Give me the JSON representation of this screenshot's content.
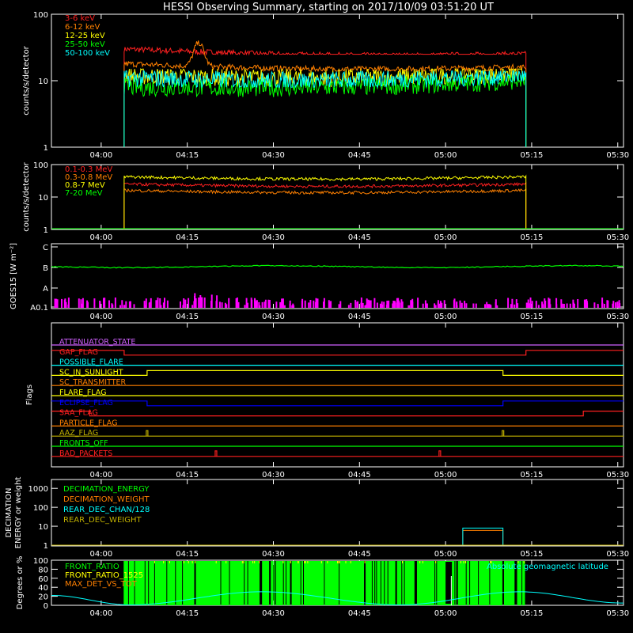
{
  "title": "HESSI Observing Summary, starting on 2017/10/09 03:51:20 UT",
  "time_ticks": [
    "04:00",
    "04:15",
    "04:30",
    "04:45",
    "05:00",
    "05:15",
    "05:30"
  ],
  "colors": {
    "red": "#ff2020",
    "orange": "#ff8000",
    "yellow": "#ffff00",
    "green": "#00ff00",
    "cyan": "#00ffff",
    "magenta": "#ff00ff",
    "blue": "#0000ff",
    "olive": "#c0b000",
    "white": "#ffffff",
    "purple": "#d060ff"
  },
  "chart_data": [
    {
      "type": "line",
      "ylabel": "counts/s/detector",
      "ylim": [
        1,
        100
      ],
      "yscale": "log",
      "ytick_labels": [
        "1",
        "10",
        "100"
      ],
      "x_range": [
        "03:51:20",
        "05:31:00"
      ],
      "data_span": [
        "04:04",
        "05:14"
      ],
      "series": [
        {
          "name": "3-6 keV",
          "color": "red",
          "start": 30,
          "end": 25,
          "min": 25,
          "max": 32
        },
        {
          "name": "6-12 keV",
          "color": "orange",
          "start": 18,
          "end": 16,
          "min": 14,
          "max": 40,
          "peak_time": "04:17",
          "peak": 40
        },
        {
          "name": "12-25 keV",
          "color": "yellow",
          "start": 12,
          "end": 13,
          "min": 7,
          "max": 15
        },
        {
          "name": "25-50 keV",
          "color": "green",
          "start": 8,
          "end": 10,
          "min": 5,
          "max": 12
        },
        {
          "name": "50-100 keV",
          "color": "cyan",
          "start": 11,
          "end": 12,
          "min": 8,
          "max": 14
        }
      ]
    },
    {
      "type": "line",
      "ylabel": "counts/s/detector",
      "ylim": [
        1,
        100
      ],
      "yscale": "log",
      "ytick_labels": [
        "1",
        "10",
        "100"
      ],
      "data_span": [
        "04:04",
        "05:14"
      ],
      "series": [
        {
          "name": "0.1-0.3 MeV",
          "color": "red",
          "level": 25
        },
        {
          "name": "0.3-0.8 MeV",
          "color": "orange",
          "level": 16
        },
        {
          "name": "0.8-7 MeV",
          "color": "yellow",
          "level": 42
        },
        {
          "name": "7-20 MeV",
          "color": "green",
          "level": 1
        }
      ]
    },
    {
      "type": "line",
      "ylabel": "GOES15 [W m⁻²]",
      "ytick_labels": [
        "A0.1",
        "A",
        "B",
        "C"
      ],
      "series": [
        {
          "name": "GOES long",
          "color": "green",
          "level_class": "B",
          "level": 1.0
        },
        {
          "name": "GOES short",
          "color": "magenta",
          "level_class": "A0.1",
          "level": 0.1
        }
      ]
    },
    {
      "type": "line",
      "ylabel": "Flags",
      "series": [
        {
          "name": "ATTENUATOR_STATE",
          "color": "purple",
          "steps": []
        },
        {
          "name": "GAP_FLAG",
          "color": "red",
          "steps": [
            [
              "03:51:20",
              1
            ],
            [
              "04:04",
              0
            ],
            [
              "05:14",
              1
            ]
          ]
        },
        {
          "name": "POSSIBLE_FLARE",
          "color": "cyan",
          "steps": []
        },
        {
          "name": "SC_IN_SUNLIGHT",
          "color": "yellow",
          "steps": [
            [
              "03:51:20",
              0
            ],
            [
              "04:08",
              1
            ],
            [
              "05:10",
              0
            ]
          ]
        },
        {
          "name": "SC_TRANSMITTER",
          "color": "orange",
          "steps": []
        },
        {
          "name": "FLARE_FLAG",
          "color": "yellow",
          "steps": []
        },
        {
          "name": "ECLIPSE_FLAG",
          "color": "blue",
          "steps": [
            [
              "03:51:20",
              1
            ],
            [
              "04:08",
              0
            ],
            [
              "05:10",
              1
            ]
          ]
        },
        {
          "name": "SAA_FLAG",
          "color": "red",
          "steps": [
            [
              "03:51:20",
              1
            ],
            [
              "03:58",
              0
            ],
            [
              "05:24",
              1
            ]
          ]
        },
        {
          "name": "PARTICLE_FLAG",
          "color": "orange",
          "steps": []
        },
        {
          "name": "AAZ_FLAG",
          "color": "olive",
          "spikes": [
            "04:08",
            "05:10"
          ]
        },
        {
          "name": "FRONTS_OFF",
          "color": "green",
          "steps": []
        },
        {
          "name": "BAD_PACKETS",
          "color": "red",
          "spikes": [
            "04:20",
            "04:59"
          ]
        }
      ]
    },
    {
      "type": "line",
      "ylabel": "DECIMATION ENERGY or weight",
      "ytick_labels": [
        "1",
        "10",
        "100",
        "1000"
      ],
      "series": [
        {
          "name": "DECIMATION_ENERGY",
          "color": "green",
          "level": 1
        },
        {
          "name": "DECIMATION_WEIGHT",
          "color": "orange",
          "level": 1,
          "pulse": [
            "05:03",
            "05:10"
          ],
          "pulse_level": 6
        },
        {
          "name": "REAR_DEC_CHAN/128",
          "color": "cyan",
          "level": 1,
          "pulse": [
            "05:03",
            "05:10"
          ],
          "pulse_level": 8
        },
        {
          "name": "REAR_DEC_WEIGHT",
          "color": "olive",
          "level": 1
        }
      ]
    },
    {
      "type": "line",
      "ylabel": "Degrees or %",
      "ylim": [
        0,
        100
      ],
      "ytick_labels": [
        "0",
        "20",
        "40",
        "60",
        "80",
        "100"
      ],
      "annotation": "Absolute geomagnetic latitude",
      "series": [
        {
          "name": "FRONT_RATIO",
          "color": "green"
        },
        {
          "name": "FRONT_RATIO_1525",
          "color": "yellow"
        },
        {
          "name": "MAX_DET_VS_TOT",
          "color": "orange"
        },
        {
          "name": "Absolute geomagnetic latitude",
          "color": "cyan",
          "points": [
            [
              "03:51:20",
              22
            ],
            [
              "04:05",
              1
            ],
            [
              "04:28",
              30
            ],
            [
              "04:52",
              1
            ],
            [
              "05:13",
              30
            ],
            [
              "05:31",
              5
            ]
          ]
        }
      ]
    }
  ]
}
